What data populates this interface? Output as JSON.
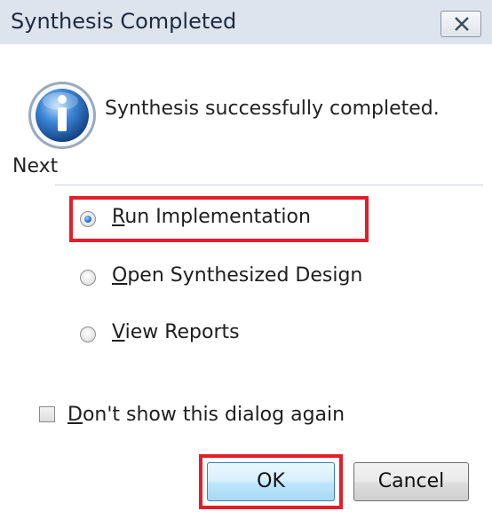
{
  "dialog": {
    "title": "Synthesis Completed",
    "close_icon": "close-icon",
    "info_icon": "info-icon",
    "message": "Synthesis successfully completed."
  },
  "next": {
    "label": "Next",
    "options": [
      {
        "accel": "R",
        "rest": "un Implementation",
        "selected": true,
        "highlighted": true
      },
      {
        "accel": "O",
        "rest": "pen Synthesized Design",
        "selected": false
      },
      {
        "accel": "V",
        "rest": "iew Reports",
        "selected": false
      }
    ]
  },
  "dont_show": {
    "accel": "D",
    "rest": "on't show this dialog again",
    "checked": false
  },
  "buttons": {
    "ok": "OK",
    "cancel": "Cancel",
    "ok_highlighted": true
  },
  "colors": {
    "highlight": "#e51d28",
    "titlebar": "#dde4ee",
    "accent": "#2c75c8"
  }
}
